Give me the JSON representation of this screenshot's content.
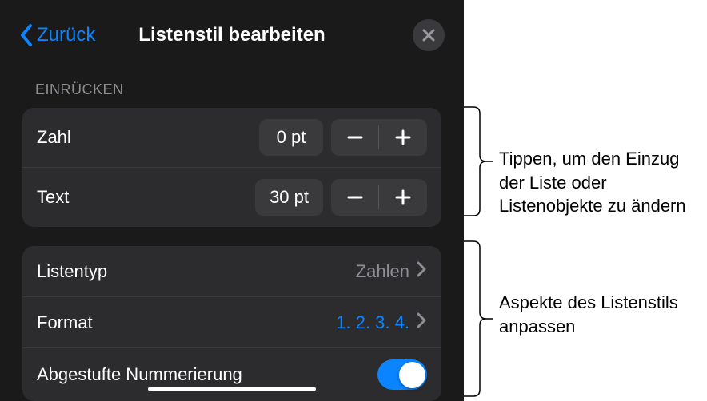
{
  "nav": {
    "back_label": "Zurück",
    "title": "Listenstil bearbeiten"
  },
  "indent": {
    "header": "EINRÜCKEN",
    "number_label": "Zahl",
    "number_value": "0 pt",
    "text_label": "Text",
    "text_value": "30 pt"
  },
  "style": {
    "listtype_label": "Listentyp",
    "listtype_value": "Zahlen",
    "format_label": "Format",
    "format_value": "1. 2. 3. 4.",
    "tiered_label": "Abgestufte Nummerierung"
  },
  "annotations": {
    "indent_note": "Tippen, um den Einzug der Liste oder Listenobjekte zu ändern",
    "style_note": "Aspekte des Listenstils anpassen"
  }
}
